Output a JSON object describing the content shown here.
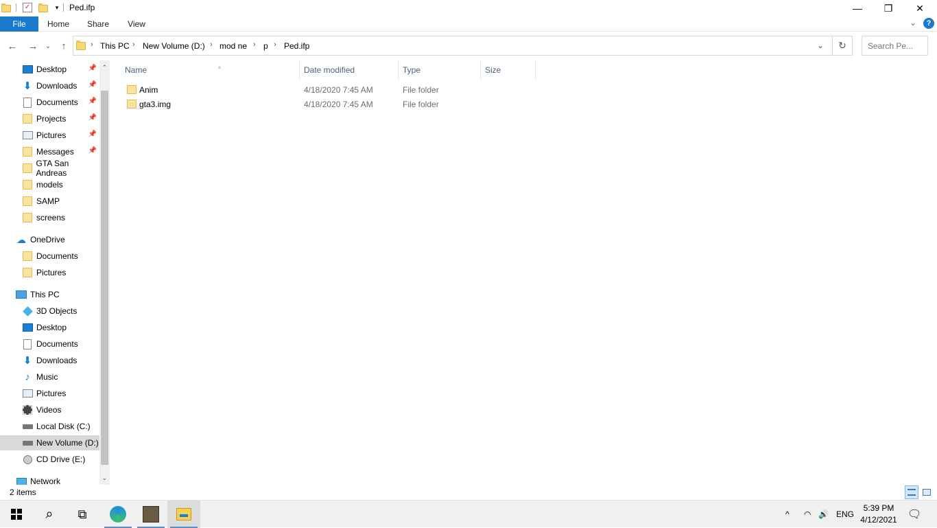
{
  "window": {
    "title": "Ped.ifp",
    "minimize": "—",
    "restore": "❐",
    "close": "✕"
  },
  "ribbon": {
    "tabs": [
      "File",
      "Home",
      "Share",
      "View"
    ],
    "expand": "⌄",
    "help": "?"
  },
  "nav": {
    "back": "←",
    "forward": "→",
    "recent": "⌄",
    "up": "↑"
  },
  "address": {
    "crumbs": [
      "This PC",
      "New Volume (D:)",
      "mod ne",
      "p",
      "Ped.ifp"
    ],
    "separator": "›",
    "dropdown": "⌄",
    "refresh": "↻"
  },
  "search": {
    "placeholder": "Search Pe..."
  },
  "navpane": {
    "quick_access": [
      {
        "label": "Desktop",
        "icon": "desktop-icon",
        "pinned": true
      },
      {
        "label": "Downloads",
        "icon": "download-icon",
        "pinned": true
      },
      {
        "label": "Documents",
        "icon": "document-icon",
        "pinned": true
      },
      {
        "label": "Projects",
        "icon": "folder-icon",
        "pinned": true
      },
      {
        "label": "Pictures",
        "icon": "pictures-icon",
        "pinned": true
      },
      {
        "label": "Messages",
        "icon": "folder-icon",
        "pinned": true
      },
      {
        "label": "GTA San Andreas",
        "icon": "folder-icon",
        "pinned": false
      },
      {
        "label": "models",
        "icon": "folder-icon",
        "pinned": false
      },
      {
        "label": "SAMP",
        "icon": "folder-icon",
        "pinned": false
      },
      {
        "label": "screens",
        "icon": "folder-icon",
        "pinned": false
      }
    ],
    "onedrive": {
      "label": "OneDrive",
      "children": [
        "Documents",
        "Pictures"
      ]
    },
    "this_pc": {
      "label": "This PC",
      "children": [
        "3D Objects",
        "Desktop",
        "Documents",
        "Downloads",
        "Music",
        "Pictures",
        "Videos",
        "Local Disk (C:)",
        "New Volume (D:)",
        "CD Drive (E:)"
      ],
      "selected": "New Volume (D:)"
    },
    "network": "Network",
    "pin_glyph": "📌",
    "scroll_up": "⌃",
    "scroll_down": "⌄"
  },
  "columns": {
    "name": "Name",
    "date": "Date modified",
    "type": "Type",
    "size": "Size",
    "sort_caret": "^"
  },
  "files": [
    {
      "name": "Anim",
      "date": "4/18/2020 7:45 AM",
      "type": "File folder",
      "size": ""
    },
    {
      "name": "gta3.img",
      "date": "4/18/2020 7:45 AM",
      "type": "File folder",
      "size": ""
    }
  ],
  "status": {
    "items": "2 items"
  },
  "taskbar": {
    "search_glyph": "⌕",
    "task_view_glyph": "⧉",
    "tray": {
      "chevron": "^",
      "wifi": "◠",
      "volume": "🔊",
      "lang": "ENG",
      "time": "5:39 PM",
      "date": "4/12/2021",
      "notification": "🗨"
    }
  },
  "colors": {
    "accent": "#1979ca",
    "selection": "#d9d9d9",
    "header_text": "#4c607a"
  }
}
